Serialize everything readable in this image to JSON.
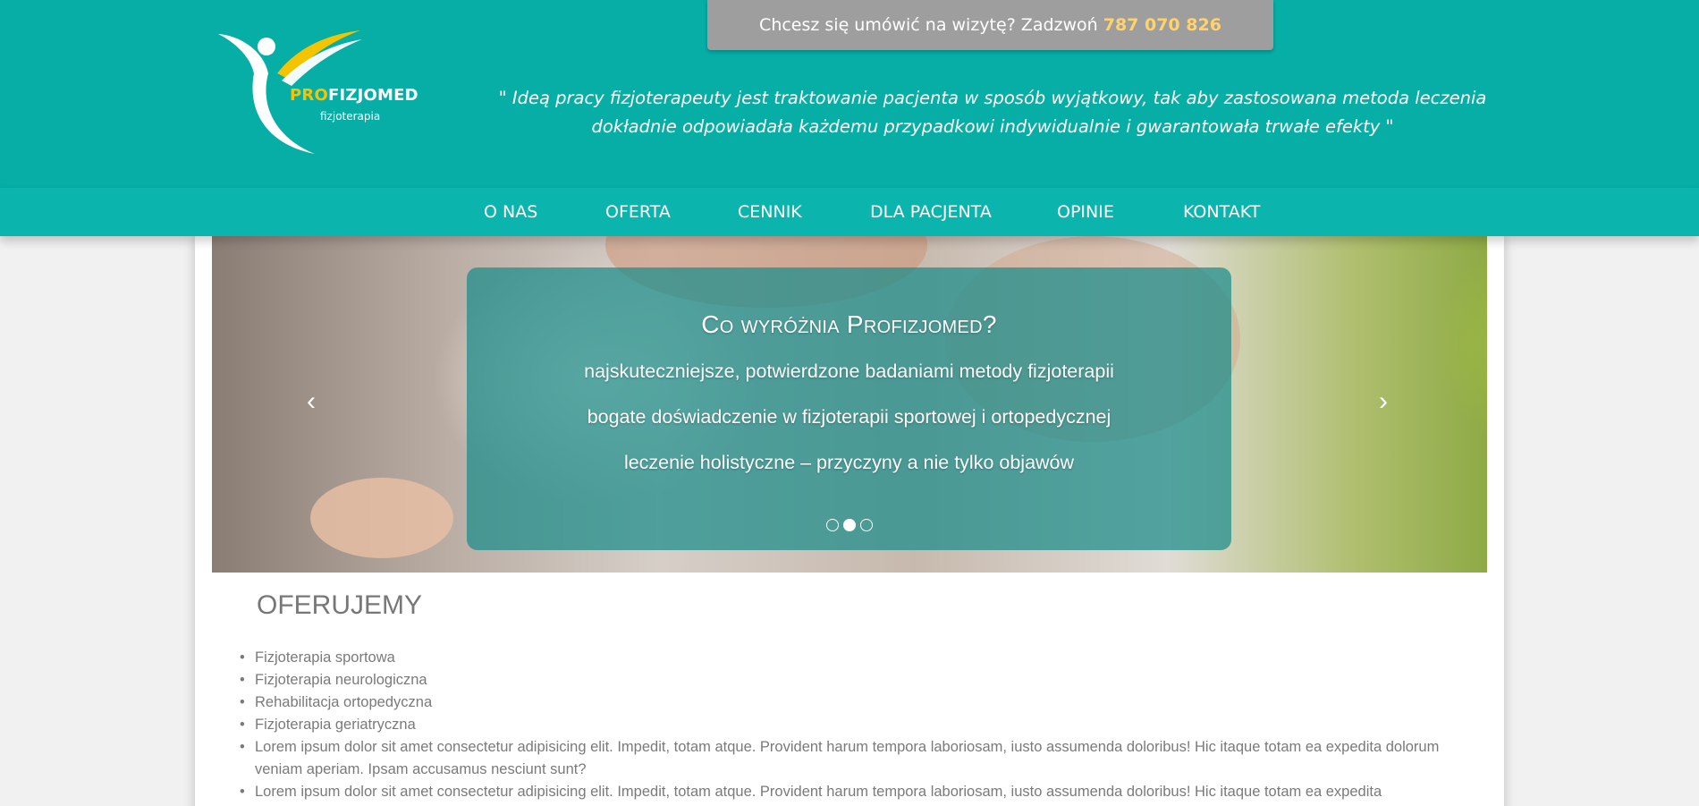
{
  "header": {
    "logo": {
      "brand_prefix": "PRO",
      "brand_suffix": "FIZJOMED",
      "subtitle": "fizjoterapia"
    },
    "call_box": {
      "text": "Chcesz się umówić na wizytę? Zadzwoń",
      "phone": "787 070 826"
    },
    "quote": "\" Ideą pracy fizjoterapeuty jest traktowanie pacjenta w sposób wyjątkowy, tak aby zastosowana metoda leczenia dokładnie odpowiadała każdemu przypadkowi indywidualnie i gwarantowała trwałe efekty \""
  },
  "nav": {
    "items": [
      {
        "label": "O NAS"
      },
      {
        "label": "OFERTA"
      },
      {
        "label": "CENNIK"
      },
      {
        "label": "DLA PACJENTA"
      },
      {
        "label": "OPINIE"
      },
      {
        "label": "KONTAKT"
      }
    ]
  },
  "slider": {
    "title": "Co wyróżnia Profizjomed?",
    "lines": [
      "najskuteczniejsze, potwierdzone badaniami metody fizjoterapii",
      "bogate doświadczenie w fizjoterapii sportowej i ortopedycznej",
      "leczenie holistyczne – przyczyny a nie tylko objawów"
    ],
    "prev_label": "‹",
    "next_label": "›",
    "active_slide": 2,
    "slide_count": 3
  },
  "content": {
    "heading": "OFERUJEMY",
    "items": [
      "Fizjoterapia sportowa",
      "Fizjoterapia neurologiczna",
      "Rehabilitacja ortopedyczna",
      "Fizjoterapia geriatryczna",
      "Lorem ipsum dolor sit amet consectetur adipisicing elit. Impedit, totam atque. Provident harum tempora laboriosam, iusto assumenda doloribus! Hic itaque totam ea expedita dolorum veniam aperiam. Ipsam accusamus nesciunt sunt?",
      "Lorem ipsum dolor sit amet consectetur adipisicing elit. Impedit, totam atque. Provident harum tempora laboriosam, iusto assumenda doloribus! Hic itaque totam ea expedita"
    ]
  },
  "colors": {
    "header_bg": "#06aea6",
    "accent_yellow": "#f5c400",
    "phone_color": "#ffd36a",
    "call_box_bg": "#9e9e9e"
  }
}
